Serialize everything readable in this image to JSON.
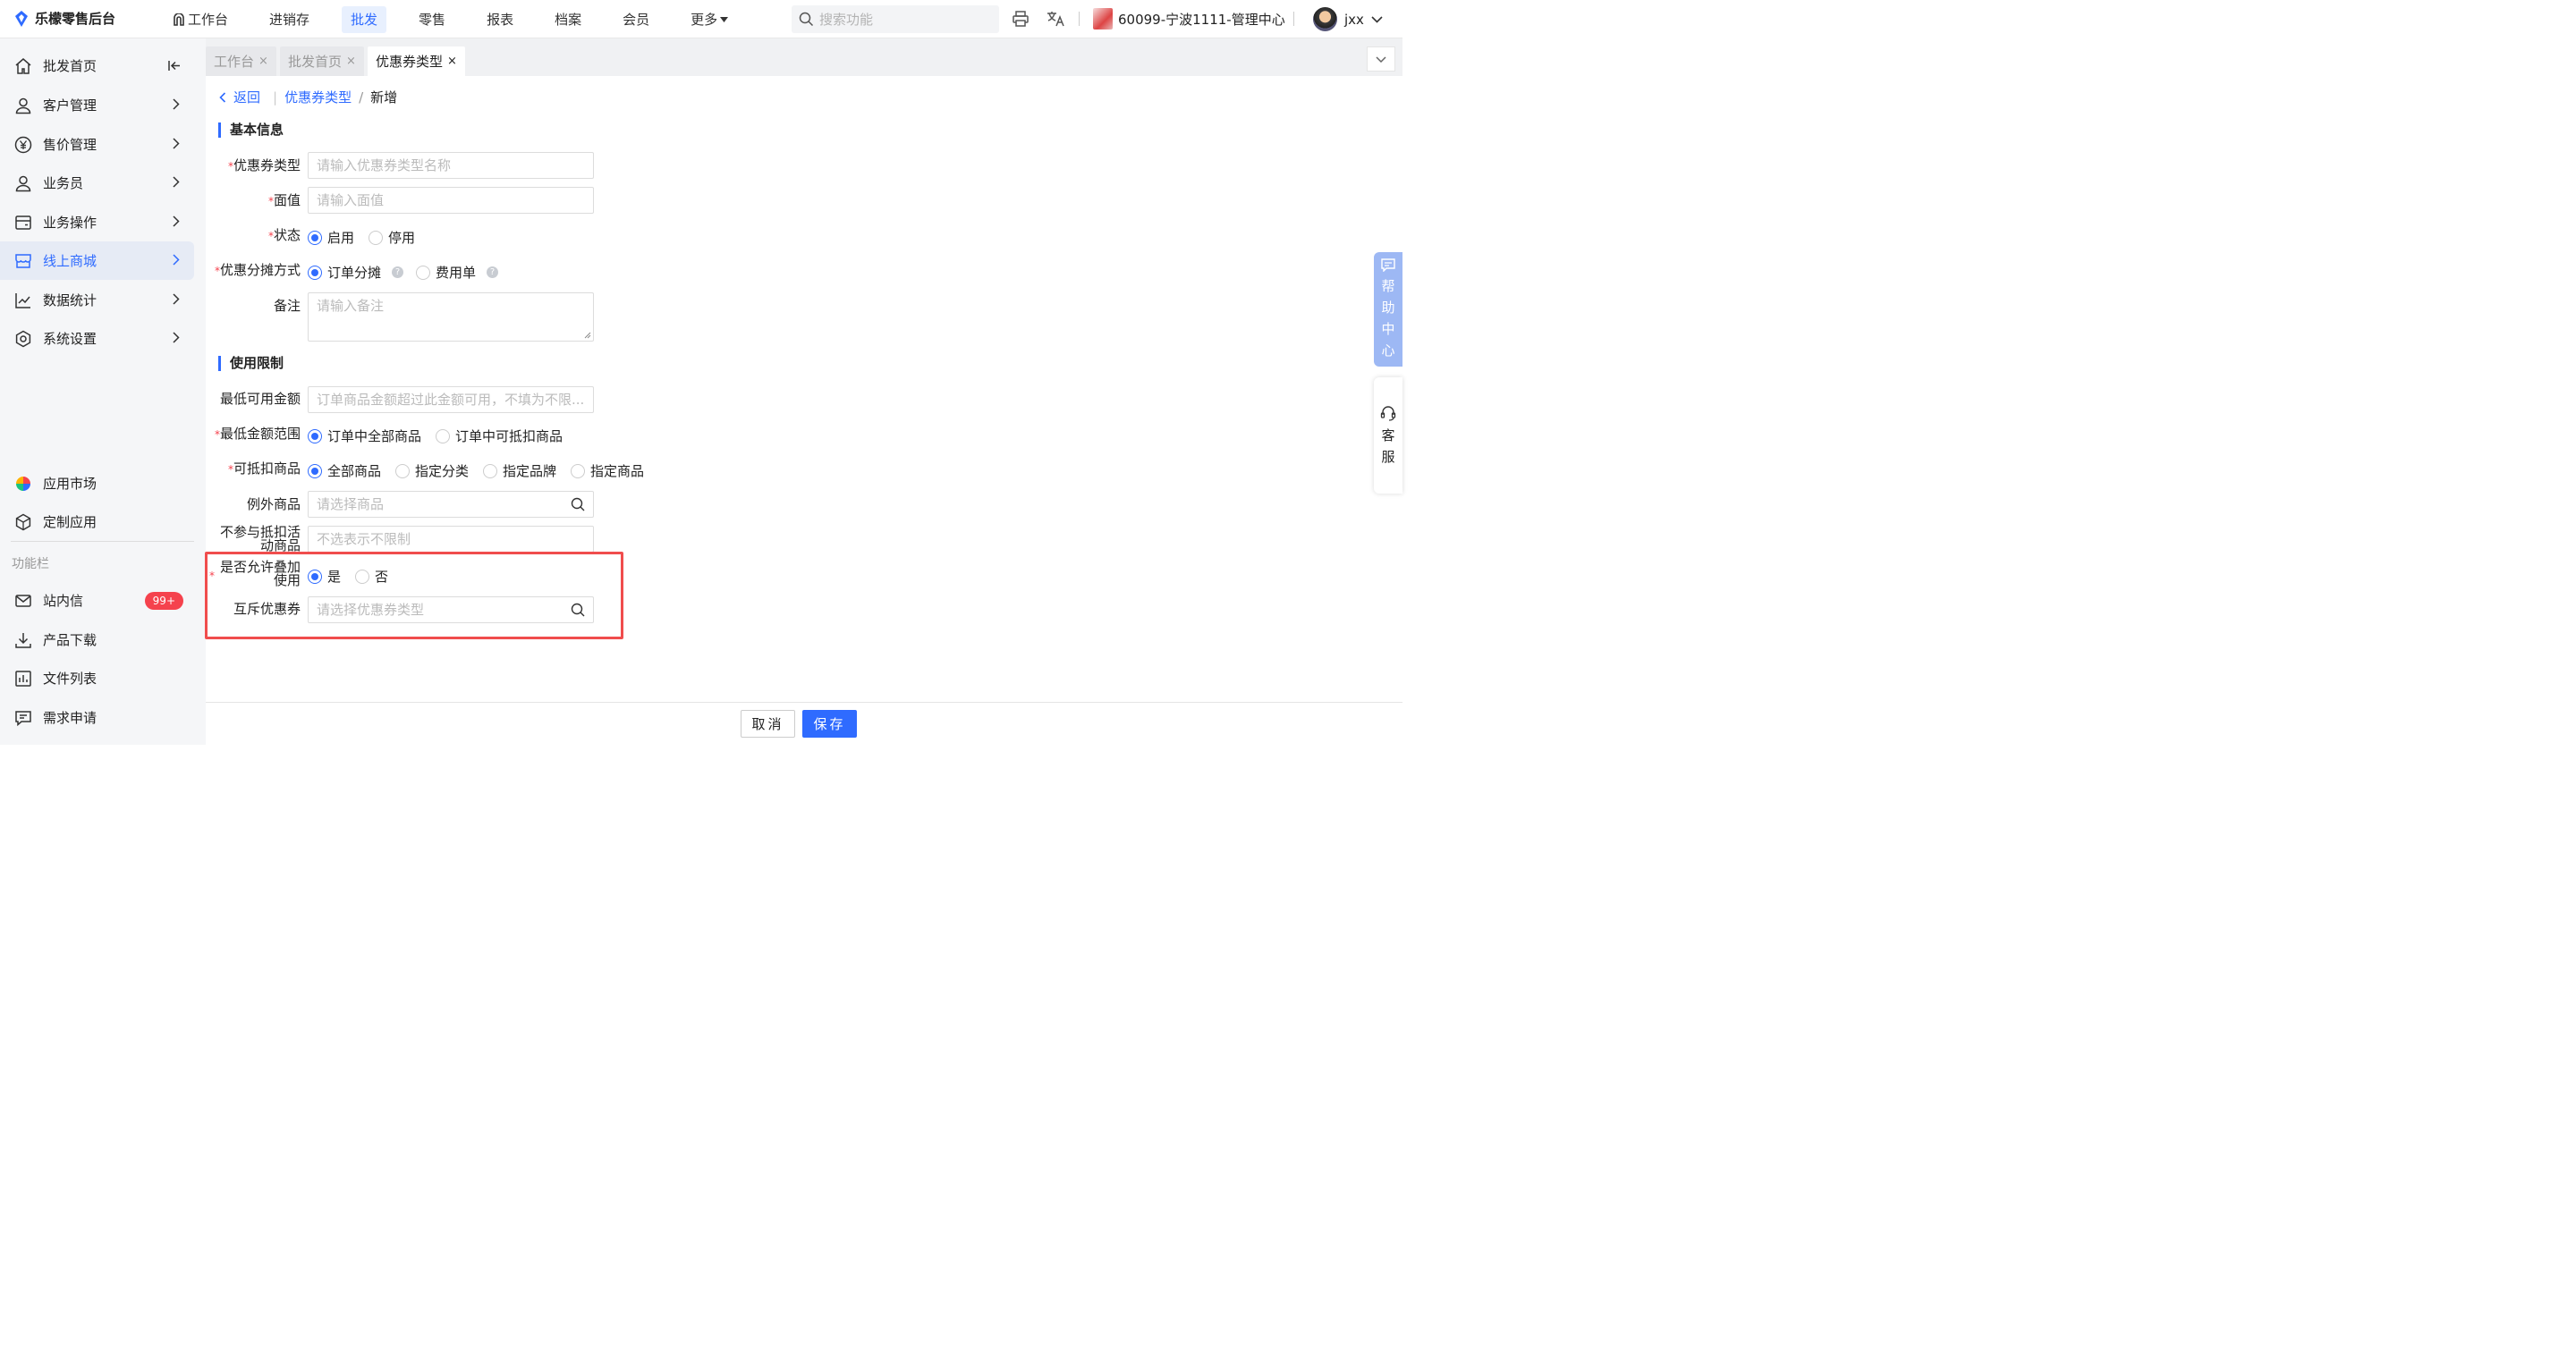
{
  "app": {
    "logo_text": "乐檬零售后台",
    "brand_color": "#2f6bff"
  },
  "topnav": {
    "items": [
      "工作台",
      "进销存",
      "批发",
      "零售",
      "报表",
      "档案",
      "会员",
      "更多"
    ],
    "active": "批发"
  },
  "search": {
    "placeholder": "搜索功能"
  },
  "store": {
    "name": "60099-宁波1111-管理中心"
  },
  "user": {
    "name": "jxx"
  },
  "sidebar": {
    "items": [
      {
        "label": "批发首页",
        "icon": "home-icon"
      },
      {
        "label": "客户管理",
        "icon": "user-icon"
      },
      {
        "label": "售价管理",
        "icon": "yuan-icon"
      },
      {
        "label": "业务员",
        "icon": "user-icon"
      },
      {
        "label": "业务操作",
        "icon": "wallet-icon"
      },
      {
        "label": "线上商城",
        "icon": "store-icon",
        "active": true
      },
      {
        "label": "数据统计",
        "icon": "chart-icon"
      },
      {
        "label": "系统设置",
        "icon": "gear-icon"
      }
    ],
    "bottom": [
      {
        "label": "应用市场",
        "icon": "app-market-icon"
      },
      {
        "label": "定制应用",
        "icon": "cube-icon"
      }
    ],
    "section_label": "功能栏",
    "func": [
      {
        "label": "站内信",
        "icon": "message-icon",
        "badge": "99+"
      },
      {
        "label": "产品下载",
        "icon": "download-icon"
      },
      {
        "label": "文件列表",
        "icon": "file-list-icon"
      },
      {
        "label": "需求申请",
        "icon": "request-icon"
      }
    ]
  },
  "tabs": [
    {
      "label": "工作台",
      "close": "×"
    },
    {
      "label": "批发首页",
      "close": "×"
    },
    {
      "label": "优惠券类型",
      "close": "×",
      "active": true
    }
  ],
  "breadcrumb": {
    "back": "返回",
    "parent": "优惠券类型",
    "sep": "/",
    "current": "新增"
  },
  "form": {
    "section_basic": "基本信息",
    "coupon_type": {
      "label": "优惠券类型",
      "placeholder": "请输入优惠券类型名称"
    },
    "face_value": {
      "label": "面值",
      "placeholder": "请输入面值"
    },
    "status": {
      "label": "状态",
      "options": [
        "启用",
        "停用"
      ],
      "selected": "启用"
    },
    "allocation": {
      "label": "优惠分摊方式",
      "options": [
        "订单分摊",
        "费用单"
      ],
      "selected": "订单分摊"
    },
    "remark": {
      "label": "备注",
      "placeholder": "请输入备注"
    },
    "section_limit": "使用限制",
    "min_amount": {
      "label": "最低可用金额",
      "placeholder": "订单商品金额超过此金额可用，不填为不限..."
    },
    "min_range": {
      "label": "最低金额范围",
      "options": [
        "订单中全部商品",
        "订单中可抵扣商品"
      ],
      "selected": "订单中全部商品"
    },
    "deductible": {
      "label": "可抵扣商品",
      "options": [
        "全部商品",
        "指定分类",
        "指定品牌",
        "指定商品"
      ],
      "selected": "全部商品"
    },
    "exception": {
      "label": "例外商品",
      "placeholder": "请选择商品"
    },
    "exclude_activity": {
      "label_line1": "不参与抵扣活",
      "label_line2": "动商品",
      "placeholder": "不选表示不限制"
    },
    "stackable": {
      "label_line1": "是否允许叠加",
      "label_line2": "使用",
      "options": [
        "是",
        "否"
      ],
      "selected": "是"
    },
    "mutex": {
      "label": "互斥优惠券",
      "placeholder": "请选择优惠券类型"
    }
  },
  "required_mark": "*",
  "footer": {
    "cancel": "取消",
    "save": "保存"
  },
  "float": {
    "help": [
      "帮",
      "助",
      "中",
      "心"
    ],
    "service": [
      "客",
      "服"
    ]
  }
}
